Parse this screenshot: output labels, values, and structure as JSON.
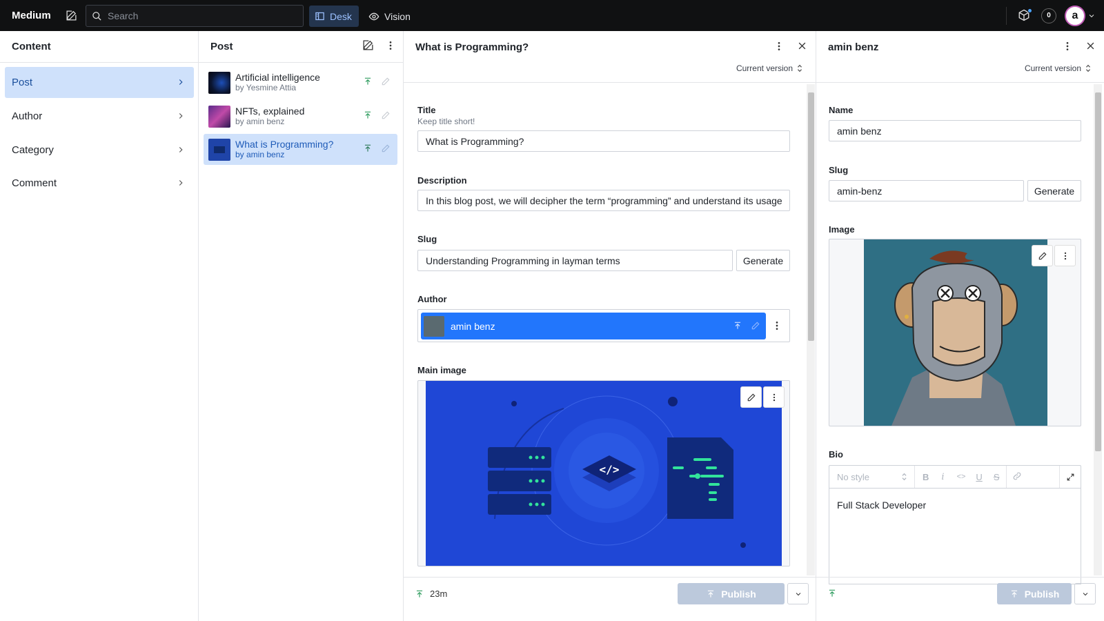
{
  "app": {
    "brand": "Medium",
    "search_placeholder": "Search",
    "tools": [
      "Desk",
      "Vision"
    ],
    "notification_count": "0",
    "avatar_letter": "a"
  },
  "content_pane": {
    "title": "Content",
    "items": [
      "Post",
      "Author",
      "Category",
      "Comment"
    ]
  },
  "post_pane": {
    "title": "Post",
    "documents": [
      {
        "title": "Artificial intelligence",
        "subtitle": "by Yesmine Attia"
      },
      {
        "title": "NFTs, explained",
        "subtitle": "by amin benz"
      },
      {
        "title": "What is Programming?",
        "subtitle": "by amin benz"
      }
    ]
  },
  "editor": {
    "title": "What is Programming?",
    "version": "Current version",
    "fields": {
      "title_label": "Title",
      "title_hint": "Keep title short!",
      "title_value": "What is Programming?",
      "description_label": "Description",
      "description_value": "In this blog post, we will decipher the term “programming” and understand its usage",
      "slug_label": "Slug",
      "slug_value": "Understanding Programming in layman terms",
      "generate": "Generate",
      "author_label": "Author",
      "author_value": "amin benz",
      "main_image_label": "Main image"
    },
    "footer": {
      "time": "23m",
      "publish": "Publish"
    }
  },
  "author_doc": {
    "title": "amin benz",
    "version": "Current version",
    "fields": {
      "name_label": "Name",
      "name_value": "amin benz",
      "slug_label": "Slug",
      "slug_value": "amin-benz",
      "generate": "Generate",
      "image_label": "Image",
      "bio_label": "Bio",
      "bio_style": "No style",
      "bio_value": "Full Stack Developer"
    },
    "footer": {
      "publish": "Publish"
    }
  },
  "colors": {
    "topbar": "#101112",
    "accent": "#2276fc",
    "selected": "#cfe1fb",
    "publish_disabled": "#bcc9dc"
  }
}
